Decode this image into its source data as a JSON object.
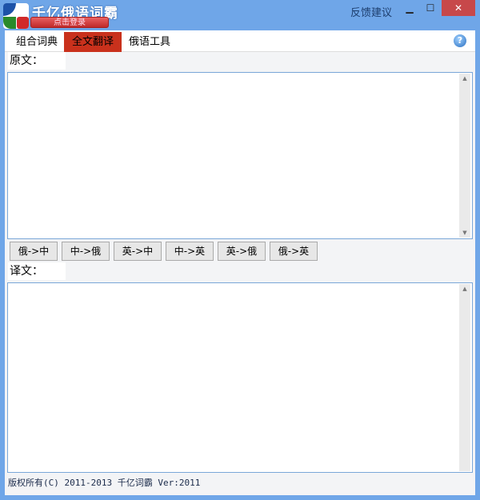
{
  "app": {
    "title": "千亿俄语词霸",
    "login_label": "点击登录",
    "feedback_label": "反馈建议"
  },
  "window_controls": {
    "minimize": "▁",
    "maximize": "☐",
    "close": "✕"
  },
  "tabs": [
    {
      "label": "组合词典"
    },
    {
      "label": "全文翻译",
      "active": true
    },
    {
      "label": "俄语工具"
    }
  ],
  "help_icon": "?",
  "source": {
    "label": "原文：",
    "value": ""
  },
  "target": {
    "label": "译文：",
    "value": ""
  },
  "buttons": [
    {
      "label": "俄->中"
    },
    {
      "label": "中->俄"
    },
    {
      "label": "英->中"
    },
    {
      "label": "中->英"
    },
    {
      "label": "英->俄"
    },
    {
      "label": "俄->英"
    }
  ],
  "footer": {
    "text": "版权所有(C) 2011-2013 千亿词霸 Ver:2011"
  },
  "colors": {
    "accent": "#c9311c",
    "frame": "#6fa6e8",
    "close": "#c7484a"
  }
}
